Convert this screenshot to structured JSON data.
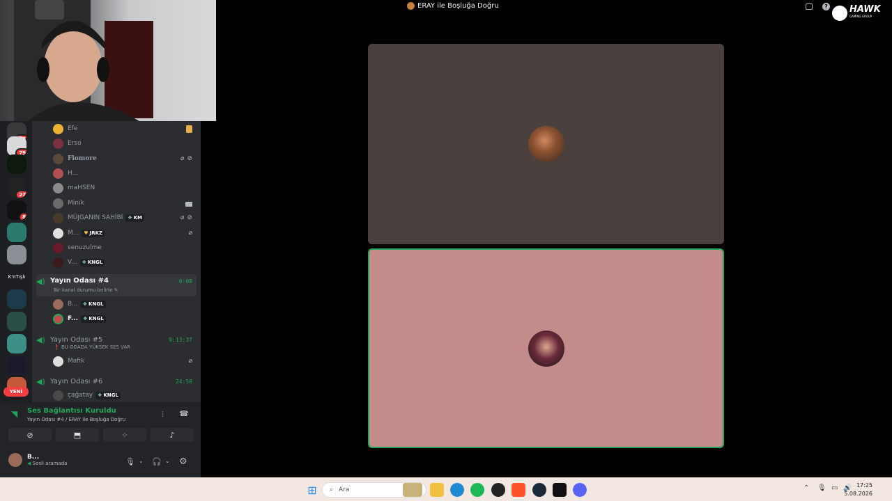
{
  "window_title": "ERAY ile Boşluğa Doğru",
  "brand": {
    "name": "HAWK",
    "tagline": "GAMING GROUP"
  },
  "rail": {
    "servers": [
      {
        "badge": "33"
      },
      {
        "badge": "79"
      },
      {
        "badge": ""
      },
      {
        "badge": "27"
      },
      {
        "badge": "8"
      },
      {
        "badge": ""
      },
      {
        "badge": ""
      },
      {
        "label": "K'nTışlı",
        "badge": ""
      },
      {
        "badge": ""
      },
      {
        "badge": ""
      },
      {
        "badge": ""
      },
      {
        "badge": ""
      },
      {
        "badge": ""
      }
    ],
    "new_label": "YENİ"
  },
  "members_top": [
    {
      "name": "Efe"
    },
    {
      "name": "Erso"
    },
    {
      "name": "Flomore"
    },
    {
      "name": "H..."
    },
    {
      "name": "maHSEN"
    },
    {
      "name": "Minik"
    },
    {
      "name": "MÜJGANIN SAHİBİ",
      "tag": "KM"
    },
    {
      "name": "M...",
      "tag": "JRKZ"
    },
    {
      "name": "senuzulme"
    },
    {
      "name": "V...",
      "tag": "KNGL"
    }
  ],
  "voice_channels": [
    {
      "name": "Yayın Odası #4",
      "timer": "0:08",
      "status": "Bir kanal durumu belirle",
      "members": [
        {
          "name": "B...",
          "tag": "KNGL"
        },
        {
          "name": "F...",
          "tag": "KNGL"
        }
      ]
    },
    {
      "name": "Yayın Odası #5",
      "timer": "9:13:37",
      "status": "BU ODADA YÜKSEK SES VAR",
      "members": [
        {
          "name": "Mafik"
        }
      ]
    },
    {
      "name": "Yayın Odası #6",
      "timer": "24:58",
      "members": [
        {
          "name": "çağatay",
          "tag": "KNGL"
        }
      ]
    }
  ],
  "voice_panel": {
    "status": "Ses Bağlantısı Kuruldu",
    "channel": "Yayın Odası #4 / ERAY ile Boşluğa Doğru"
  },
  "user": {
    "name": "B...",
    "status": "Sesli aramada"
  },
  "taskbar": {
    "search_placeholder": "Ara",
    "time": "17:25",
    "date": "5.08.2026"
  },
  "colors": {
    "tile_top": "#4a403e",
    "tile_bottom": "#c48b8b",
    "accent_green": "#23a55a"
  }
}
